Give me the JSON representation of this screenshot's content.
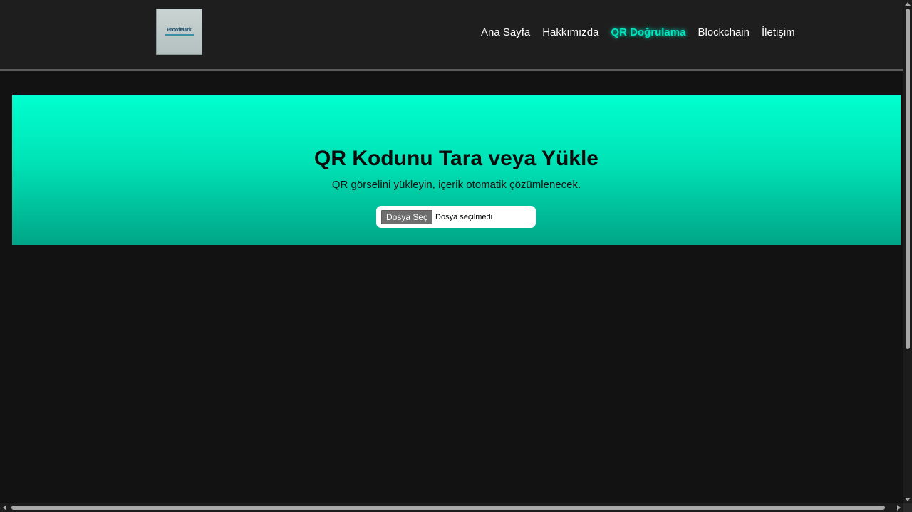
{
  "header": {
    "logo_text": "ProofMark",
    "nav": [
      {
        "label": "Ana Sayfa"
      },
      {
        "label": "Hakkımızda"
      },
      {
        "label": "QR Doğrulama",
        "active": true
      },
      {
        "label": "Blockchain"
      },
      {
        "label": "İletişim"
      }
    ]
  },
  "hero": {
    "title": "QR Kodunu Tara veya Yükle",
    "subtitle": "QR görselini yükleyin, içerik otomatik çözümlenecek.",
    "file_button": "Dosya Seç",
    "file_status": "Dosya seçilmedi"
  },
  "colors": {
    "accent": "#00e5c0",
    "background": "#121212",
    "header": "#1e1e1e"
  }
}
